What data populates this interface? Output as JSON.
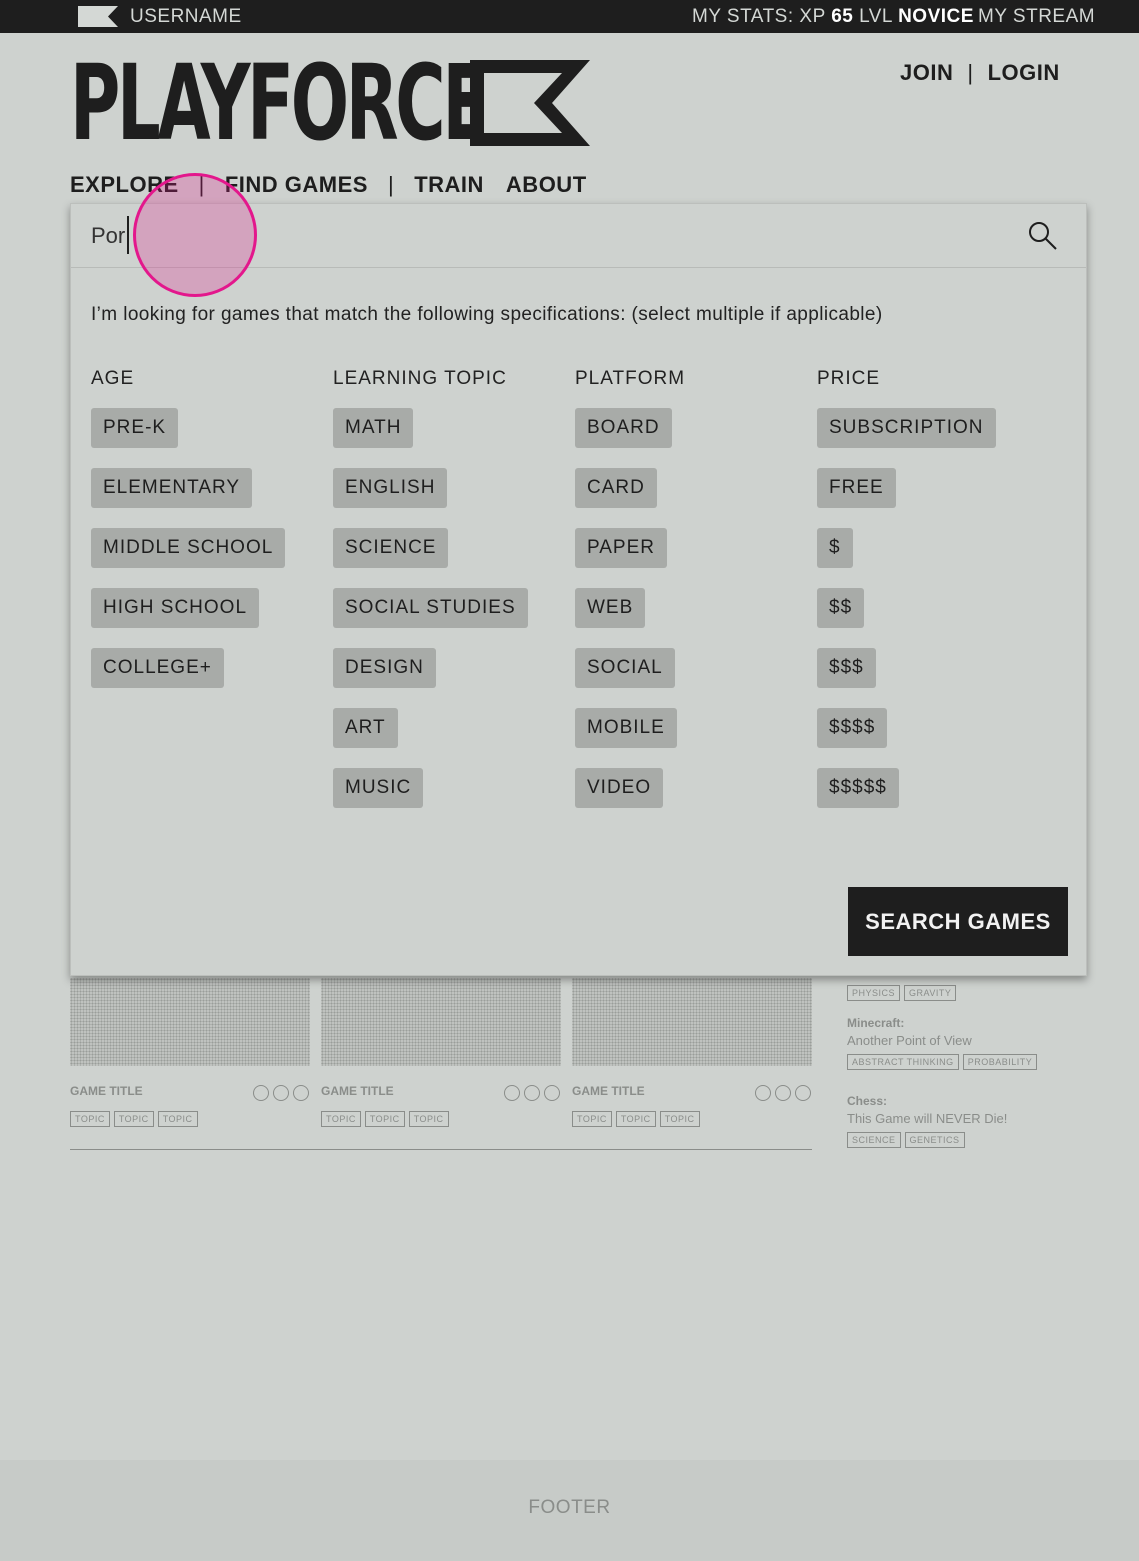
{
  "topbar": {
    "username": "USERNAME",
    "stats_prefix": "MY STATS: XP ",
    "xp": "65",
    "lvl_label": " LVL ",
    "level": "NOVICE",
    "stream": "MY STREAM"
  },
  "logo": {
    "text": "PLAYFORCE"
  },
  "auth": {
    "join": "JOIN",
    "login": "LOGIN",
    "sep": "|"
  },
  "nav": {
    "explore": "EXPLORE",
    "find_games": "FIND GAMES",
    "train": "TRAIN",
    "about": "ABOUT",
    "sep": "|"
  },
  "search": {
    "value": "Por",
    "intro": "I’m looking for games that match the following specifications: (select multiple if applicable)",
    "columns": [
      {
        "heading": "AGE",
        "options": [
          "PRE-K",
          "ELEMENTARY",
          "MIDDLE SCHOOL",
          "HIGH SCHOOL",
          "COLLEGE+"
        ]
      },
      {
        "heading": "LEARNING TOPIC",
        "options": [
          "MATH",
          "ENGLISH",
          "SCIENCE",
          "SOCIAL STUDIES",
          "DESIGN",
          "ART",
          "MUSIC"
        ]
      },
      {
        "heading": "PLATFORM",
        "options": [
          "BOARD",
          "CARD",
          "PAPER",
          "WEB",
          "SOCIAL",
          "MOBILE",
          "VIDEO"
        ]
      },
      {
        "heading": "PRICE",
        "options": [
          "SUBSCRIPTION",
          "FREE",
          "$",
          "$$",
          "$$$",
          "$$$$",
          "$$$$$"
        ]
      }
    ],
    "button": "SEARCH GAMES"
  },
  "games": [
    {
      "title": "GAME TITLE",
      "tags": [
        "TOPIC",
        "TOPIC",
        "TOPIC"
      ]
    },
    {
      "title": "GAME TITLE",
      "tags": [
        "TOPIC",
        "TOPIC",
        "TOPIC"
      ]
    },
    {
      "title": "GAME TITLE",
      "tags": [
        "TOPIC",
        "TOPIC",
        "TOPIC"
      ]
    }
  ],
  "sidebar": {
    "top_tags": [
      "PHYSICS",
      "GRAVITY"
    ],
    "posts": [
      {
        "title": "Minecraft:",
        "desc": "Another Point of View",
        "tags": [
          "ABSTRACT THINKING",
          "PROBABILITY"
        ]
      },
      {
        "title": "Chess:",
        "desc": "This Game will NEVER Die!",
        "tags": [
          "SCIENCE",
          "GENETICS"
        ]
      }
    ]
  },
  "footer": {
    "label": "FOOTER"
  },
  "colors": {
    "dark": "#1e1e1e",
    "page": "#ced2cf",
    "chip": "#a8aba8",
    "touch": "#e3178c"
  }
}
